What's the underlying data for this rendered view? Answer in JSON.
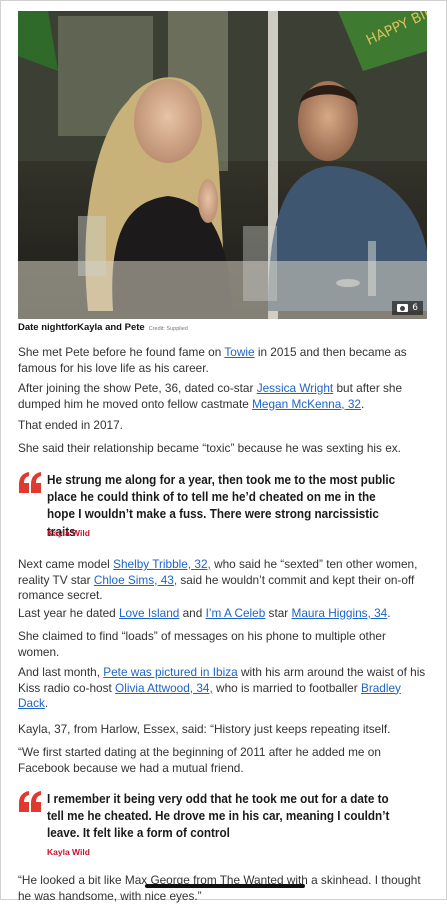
{
  "photo": {
    "alt_icon": "camera-icon",
    "count": "6",
    "caption": "Date nightforKayla and Pete",
    "credit": "Credit: Supplied",
    "banner_text": "HAPPY BIRTHDAY"
  },
  "paragraphs": {
    "p1_a": "She met Pete before he found fame on ",
    "p1_link": "Towie",
    "p1_b": " in 2015 and then became as famous for his love life as his career.",
    "p2_a": "After joining the show Pete, 36, dated co-star ",
    "p2_link1": "Jessica Wright",
    "p2_b": " but after she dumped him he moved onto fellow castmate ",
    "p2_link2": "Megan McKenna, 32",
    "p2_c": ".",
    "p3": "That ended in 2017.",
    "p4": "She said their relationship became “toxic” because he was sexting his ex.",
    "p5_a": "Next came model ",
    "p5_link1": "Shelby Tribble, 32,",
    "p5_b": " who said he “sexted” ten other women, reality TV star ",
    "p5_link2": "Chloe Sims, 43,",
    "p5_c": " said he wouldn’t commit and kept their on-off romance secret.",
    "p6_a": "Last year he dated ",
    "p6_link1": "Love Island",
    "p6_b": " and ",
    "p6_link2": "I’m A Celeb",
    "p6_c": " star ",
    "p6_link3": "Maura Higgins, 34",
    "p6_d": ".",
    "p7": "She claimed to find “loads” of messages on his phone to multiple other women.",
    "p8_a": "And last month, ",
    "p8_link1": "Pete was pictured in Ibiza",
    "p8_b": " with his arm around the waist of his Kiss radio co-host ",
    "p8_link2": "Olivia Attwood, 34,",
    "p8_c": " who is married to footballer ",
    "p8_link3": "Bradley Dack",
    "p8_d": ".",
    "p9": "Kayla, 37, from Harlow, Essex, said: “History just keeps repeating itself.",
    "p10": "“We first started dating at the beginning of 2011 after he added me on Facebook because we had a mutual friend.",
    "p11": "“He looked a bit like Max George from The Wanted with a skinhead. I thought he was handsome, with nice eyes.”"
  },
  "quotes": {
    "q1_text": "He strung me along for a year, then took me to the most public place he could think of to tell me he’d cheated on me in the hope I wouldn’t make a fuss. There were strong narcissistic traits",
    "q1_attr": "Kayla Wild",
    "q2_text": "I remember it being very odd that he took me out for a date to tell me he cheated. He drove me in his car, meaning I couldn’t leave. It felt like a form of control",
    "q2_attr": "Kayla Wild",
    "quote_icon": "quote-mark-icon",
    "accent": "#e03a2f"
  },
  "colors": {
    "link": "#1e64c8",
    "attribution": "#c8102e"
  }
}
